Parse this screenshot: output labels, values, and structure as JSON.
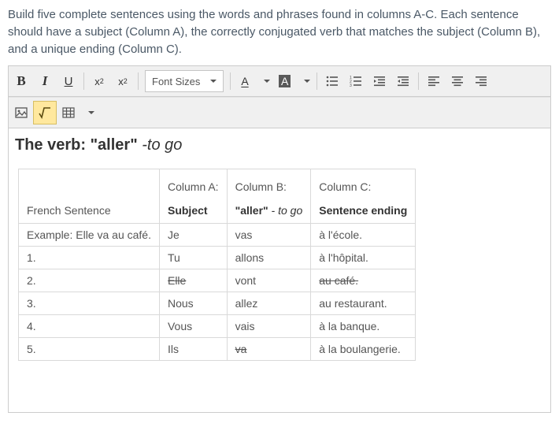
{
  "instructions": "Build five complete sentences using the words and phrases found in columns A-C. Each sentence should have a subject (Column A), the correctly conjugated verb that matches the subject (Column B), and a unique ending (Column C).",
  "toolbar": {
    "font_sizes_label": "Font Sizes",
    "text_color_letter": "A",
    "bg_color_letter": "A"
  },
  "heading": {
    "prefix": "The verb: \"aller\" ",
    "italic": "-to go"
  },
  "columns": {
    "corner_label": "French Sentence",
    "a": {
      "title": "Column A:",
      "sub": "Subject"
    },
    "b": {
      "title": "Column B:",
      "sub_plain": "\"aller\"",
      "sub_italic": " - to go"
    },
    "c": {
      "title": "Column C:",
      "sub": "Sentence ending"
    }
  },
  "rows": [
    {
      "label": "Example: Elle va au café.",
      "a": "Je",
      "a_strike": false,
      "b": "vas",
      "b_strike": false,
      "c": "à l'école.",
      "c_strike": false
    },
    {
      "label": "1.",
      "a": "Tu",
      "a_strike": false,
      "b": "allons",
      "b_strike": false,
      "c": "à l'hôpital.",
      "c_strike": false
    },
    {
      "label": "2.",
      "a": "Elle",
      "a_strike": true,
      "b": "vont",
      "b_strike": false,
      "c": "au café.",
      "c_strike": true
    },
    {
      "label": "3.",
      "a": "Nous",
      "a_strike": false,
      "b": "allez",
      "b_strike": false,
      "c": "au restaurant.",
      "c_strike": false
    },
    {
      "label": "4.",
      "a": "Vous",
      "a_strike": false,
      "b": "vais",
      "b_strike": false,
      "c": "à la banque.",
      "c_strike": false
    },
    {
      "label": "5.",
      "a": "Ils",
      "a_strike": false,
      "b": "va",
      "b_strike": true,
      "c": "à la boulangerie.",
      "c_strike": false
    }
  ]
}
